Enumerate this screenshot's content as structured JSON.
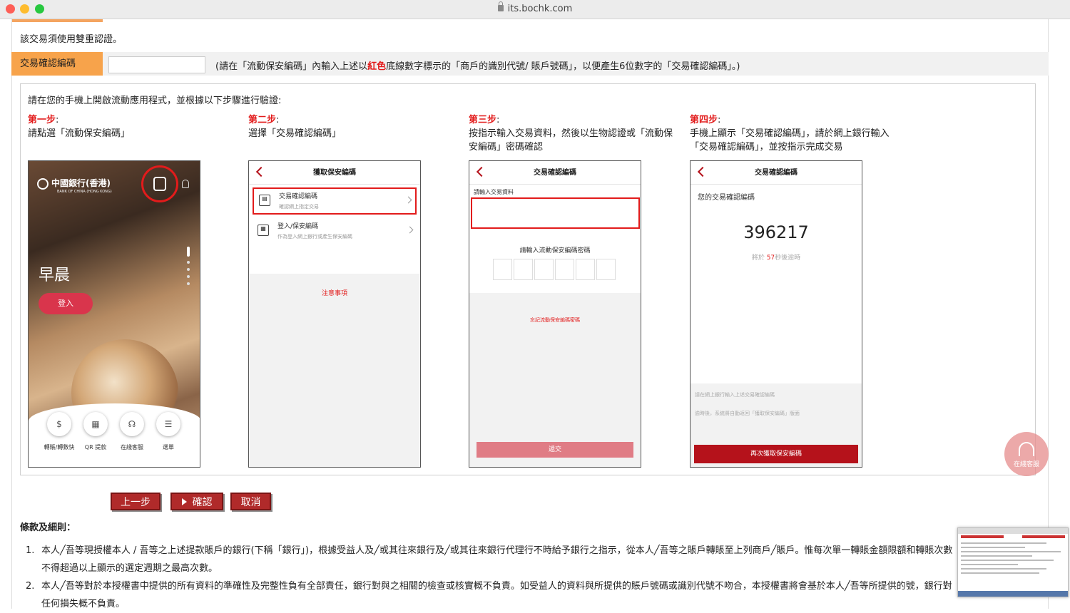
{
  "browser": {
    "url": "its.bochk.com"
  },
  "intro": "該交易須使用雙重認證。",
  "code_row": {
    "label": "交易確認編碼",
    "input_value": "",
    "note_before": "(請在「流動保安編碼」內輸入上述以",
    "note_red": "紅色",
    "note_after": "底線數字標示的「商戶的識別代號/ 賬戶號碼」，以便產生6位數字的「交易確認編碼」。)"
  },
  "steps_intro": "請在您的手機上開啟流動應用程式，並根據以下步驟進行驗證:",
  "steps": [
    {
      "title": "第一步",
      "colon": ":",
      "text": "請點選「流動保安編碼」"
    },
    {
      "title": "第二步",
      "colon": ":",
      "text": "選擇「交易確認編碼」"
    },
    {
      "title": "第三步",
      "colon": ":",
      "text": "按指示輸入交易資料，然後以生物認證或「流動保安編碼」密碼確認"
    },
    {
      "title": "第四步",
      "colon": ":",
      "text": "手機上顯示「交易確認編碼」，請於網上銀行輸入「交易確認編碼」，並按指示完成交易"
    }
  ],
  "phone1": {
    "logo": "中國銀行(香港)",
    "logo_sub": "BANK OF CHINA (HONG KONG)",
    "greeting": "早晨",
    "login": "登入",
    "quick": [
      {
        "label": "轉賬/轉數快",
        "icon": "$"
      },
      {
        "label": "QR 提款",
        "icon": "▦"
      },
      {
        "label": "在綫客服",
        "icon": "☊"
      },
      {
        "label": "選單",
        "icon": "☰"
      }
    ]
  },
  "phone2": {
    "title": "獲取保安編碼",
    "items": [
      {
        "t1": "交易確認編碼",
        "t2": "確認網上指定交易"
      },
      {
        "t1": "登入/保安編碼",
        "t2": "作為登入網上銀行或產生保安編碼"
      }
    ],
    "notes": "注意事項"
  },
  "phone3": {
    "title": "交易確認編碼",
    "label_input": "請輸入交易資料",
    "label_pin": "請輸入流動保安編碼密碼",
    "forgot": "忘記流動保安編碼密碼",
    "submit": "遞交"
  },
  "phone4": {
    "title": "交易確認編碼",
    "label": "您的交易確認編碼",
    "code": "396217",
    "timer_pre": "將於 ",
    "timer_sec": "57",
    "timer_post": "秒後逾時",
    "note1": "請在網上銀行輸入上述交易確認編碼",
    "note2": "逾時後，系統將自動返回「獲取保安編碼」版面",
    "again": "再次獲取保安編碼"
  },
  "buttons": {
    "back": "上一步",
    "confirm": "確認",
    "cancel": "取消"
  },
  "terms": {
    "title": "條款及細則：",
    "items": [
      {
        "num": "1.",
        "text": "本人╱吾等現授權本人 / 吾等之上述提款賬戶的銀行(下稱「銀行」)，根據受益人及╱或其往來銀行及╱或其往來銀行代理行不時給予銀行之指示，從本人╱吾等之賬戶轉賬至上列商戶╱賬戶。惟每次單一轉賬金額限額和轉賬次數不得超過以上顯示的選定週期之最高次數。"
      },
      {
        "num": "2.",
        "text": "本人╱吾等對於本授權書中提供的所有資料的準確性及完整性負有全部責任，銀行對與之相關的檢查或核實概不負責。如受益人的資料與所提供的賬戶號碼或識別代號不吻合，本授權書將會基於本人╱吾等所提供的號，銀行對任何損失概不負責。"
      }
    ]
  },
  "chat": {
    "label": "在綫客服"
  },
  "colors": {
    "accent": "#f7a34b",
    "brand": "#b5121b",
    "red": "#e21b1b"
  }
}
